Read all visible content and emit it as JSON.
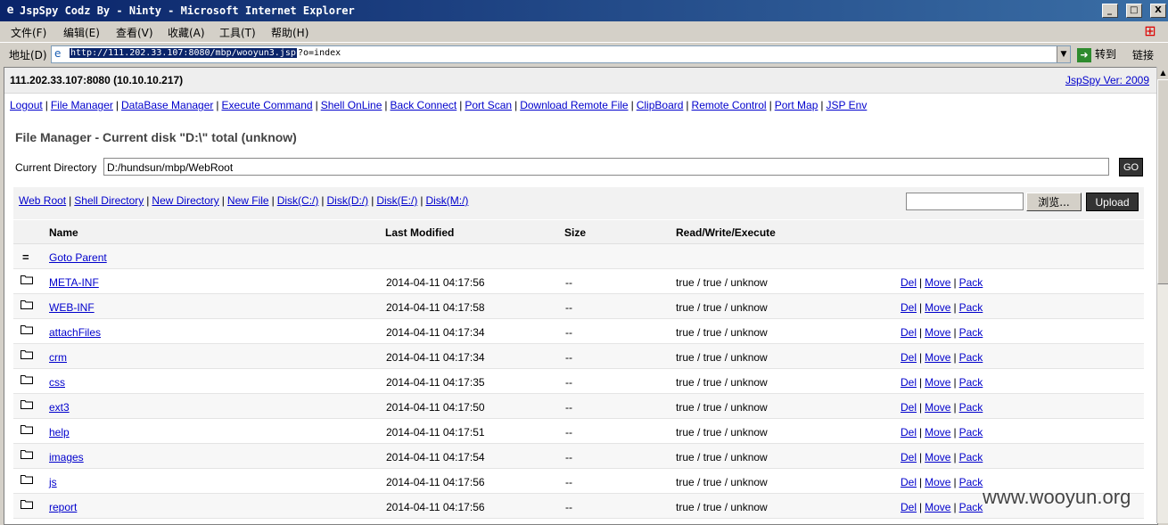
{
  "window": {
    "title": "JspSpy Codz By - Ninty - Microsoft Internet Explorer",
    "minimize": "_",
    "maximize": "□",
    "close": "X"
  },
  "menu": [
    "文件(F)",
    "编辑(E)",
    "查看(V)",
    "收藏(A)",
    "工具(T)",
    "帮助(H)"
  ],
  "addressbar": {
    "label": "地址(D)",
    "url_selected": "http://111.202.33.107:8080/mbp/wooyun3.jsp",
    "url_rest": "?o=index",
    "go_label": "转到",
    "links_label": "链接"
  },
  "header": {
    "host": "111.202.33.107:8080 (10.10.10.217)",
    "version": "JspSpy Ver: 2009"
  },
  "nav": [
    "Logout",
    "File Manager",
    "DataBase Manager",
    "Execute Command",
    "Shell OnLine",
    "Back Connect",
    "Port Scan",
    "Download Remote File",
    "ClipBoard",
    "Remote Control",
    "Port Map",
    "JSP Env"
  ],
  "filemanager": {
    "heading": "File Manager - Current disk \"D:\\\" total (unknow)",
    "current_directory_label": "Current Directory",
    "current_directory": "D:/hundsun/mbp/WebRoot",
    "go_label": "GO",
    "actions": [
      "Web Root",
      "Shell Directory",
      "New Directory",
      "New File",
      "Disk(C:/)",
      "Disk(D:/)",
      "Disk(E:/)",
      "Disk(M:/)"
    ],
    "browse_label": "浏览...",
    "upload_label": "Upload"
  },
  "table": {
    "headers": {
      "name": "Name",
      "modified": "Last Modified",
      "size": "Size",
      "rwx": "Read/Write/Execute"
    },
    "parent_label": "Goto Parent",
    "rows": [
      {
        "name": "META-INF",
        "modified": "2014-04-11 04:17:56",
        "size": "--",
        "rwx": "true / true / unknow"
      },
      {
        "name": "WEB-INF",
        "modified": "2014-04-11 04:17:58",
        "size": "--",
        "rwx": "true / true / unknow"
      },
      {
        "name": "attachFiles",
        "modified": "2014-04-11 04:17:34",
        "size": "--",
        "rwx": "true / true / unknow"
      },
      {
        "name": "crm",
        "modified": "2014-04-11 04:17:34",
        "size": "--",
        "rwx": "true / true / unknow"
      },
      {
        "name": "css",
        "modified": "2014-04-11 04:17:35",
        "size": "--",
        "rwx": "true / true / unknow"
      },
      {
        "name": "ext3",
        "modified": "2014-04-11 04:17:50",
        "size": "--",
        "rwx": "true / true / unknow"
      },
      {
        "name": "help",
        "modified": "2014-04-11 04:17:51",
        "size": "--",
        "rwx": "true / true / unknow"
      },
      {
        "name": "images",
        "modified": "2014-04-11 04:17:54",
        "size": "--",
        "rwx": "true / true / unknow"
      },
      {
        "name": "js",
        "modified": "2014-04-11 04:17:56",
        "size": "--",
        "rwx": "true / true / unknow"
      },
      {
        "name": "report",
        "modified": "2014-04-11 04:17:56",
        "size": "--",
        "rwx": "true / true / unknow"
      }
    ],
    "ops": {
      "del": "Del",
      "move": "Move",
      "pack": "Pack"
    }
  },
  "watermark": "www.wooyun.org"
}
